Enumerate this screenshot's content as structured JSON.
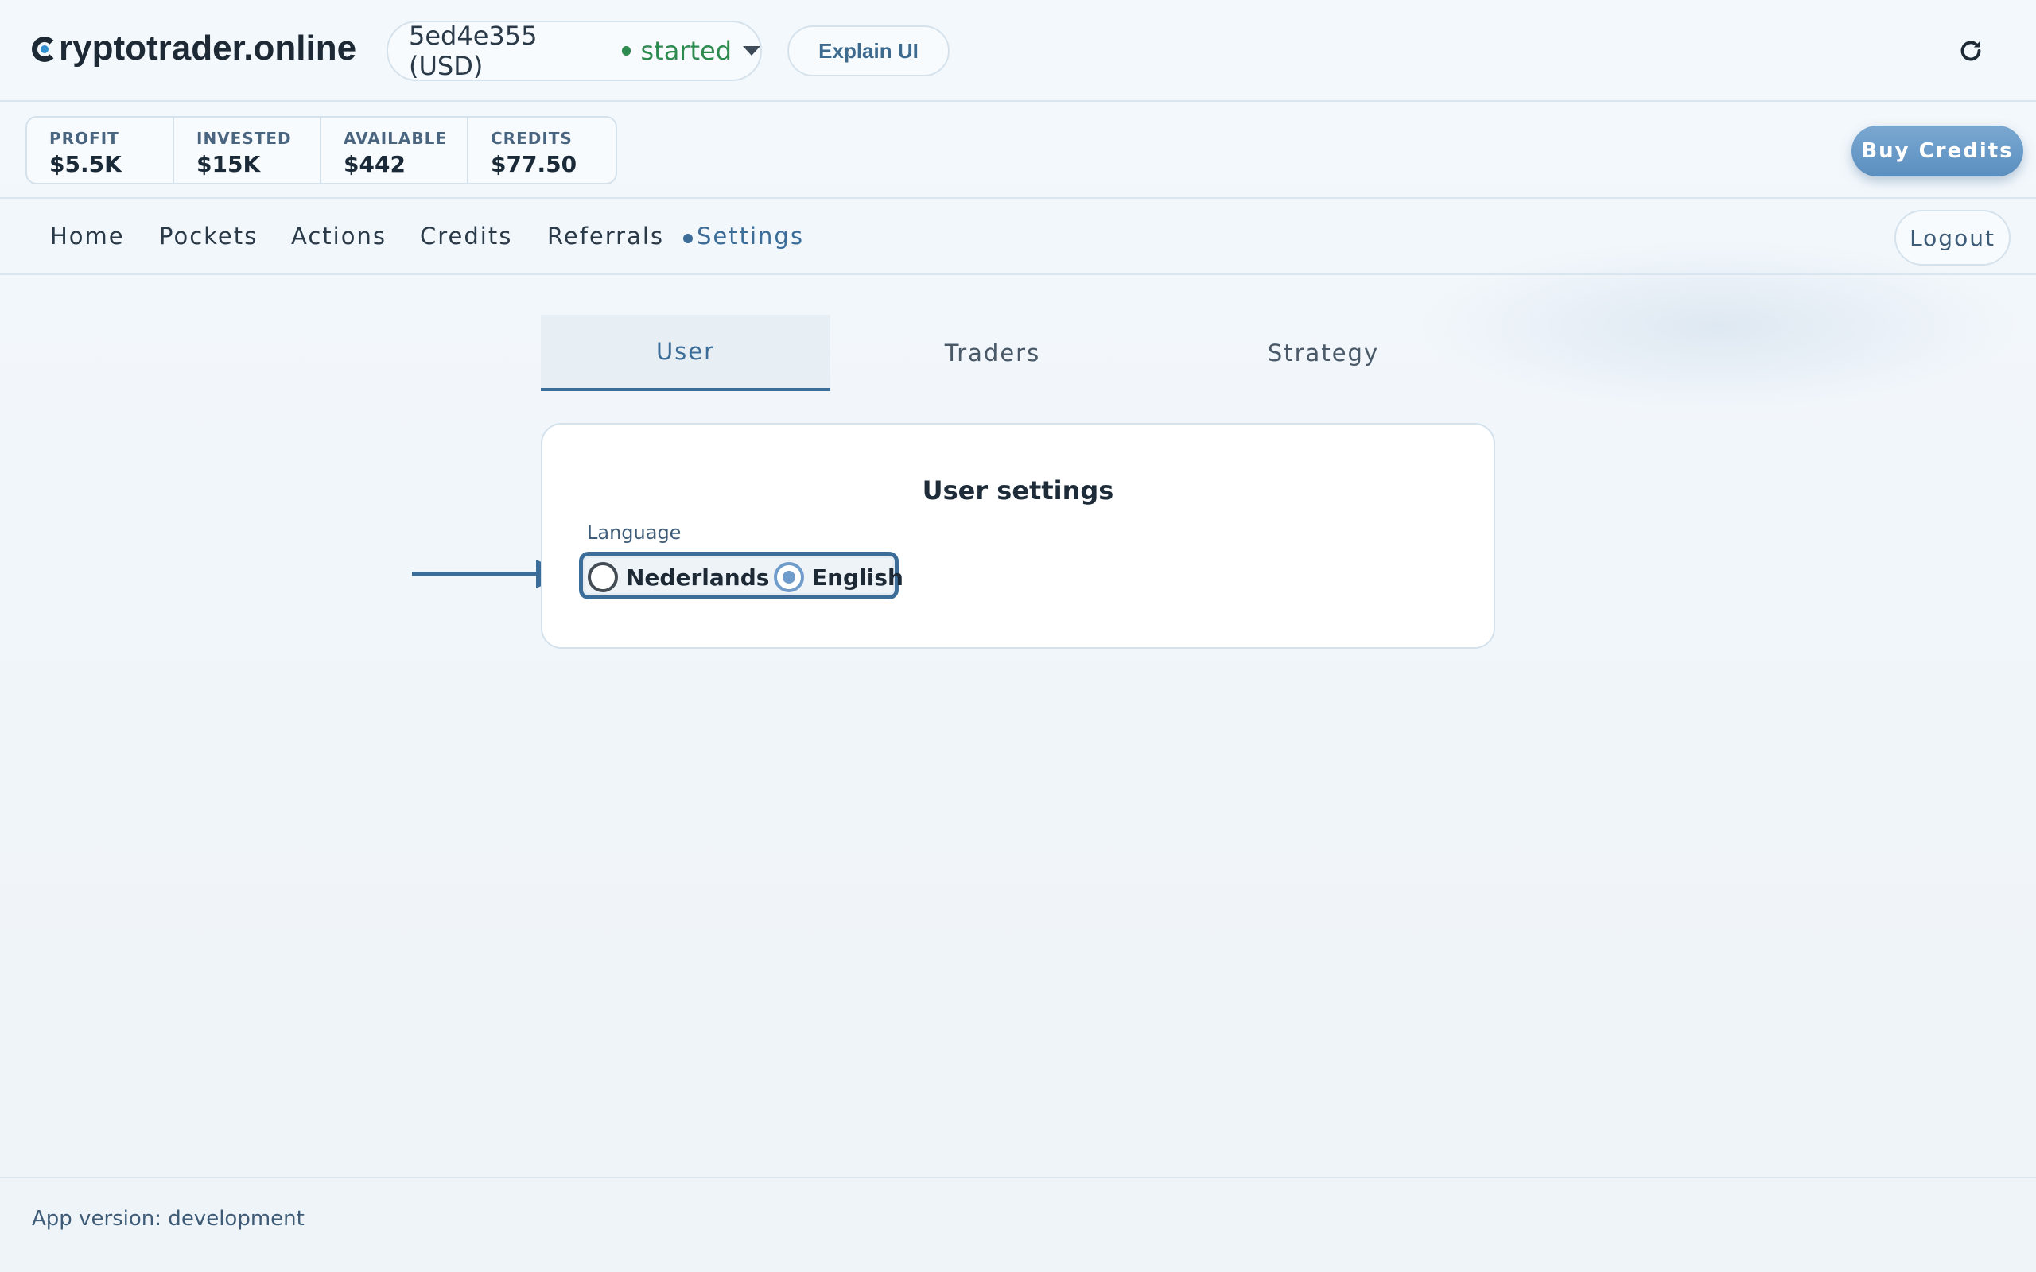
{
  "header": {
    "logo_text": "ryptotrader.online",
    "pocket": {
      "name": "5ed4e355 (USD)",
      "status": "started",
      "status_color": "#2e8b4f"
    },
    "explain_label": "Explain UI",
    "refresh_icon": "refresh-icon"
  },
  "stats": [
    {
      "label": "PROFIT",
      "value": "$5.5K"
    },
    {
      "label": "INVESTED",
      "value": "$15K"
    },
    {
      "label": "AVAILABLE",
      "value": "$442"
    },
    {
      "label": "CREDITS",
      "value": "$77.50"
    }
  ],
  "buy_credits_label": "Buy Credits",
  "nav": {
    "items": [
      {
        "label": "Home"
      },
      {
        "label": "Pockets"
      },
      {
        "label": "Actions"
      },
      {
        "label": "Credits"
      },
      {
        "label": "Referrals"
      },
      {
        "label": "Settings",
        "active": true
      }
    ],
    "logout_label": "Logout"
  },
  "tabs": [
    {
      "label": "User",
      "active": true
    },
    {
      "label": "Traders"
    },
    {
      "label": "Strategy"
    }
  ],
  "user_settings": {
    "title": "User settings",
    "language_label": "Language",
    "options": [
      {
        "label": "Nederlands",
        "selected": false
      },
      {
        "label": "English",
        "selected": true
      }
    ]
  },
  "footer": {
    "version_text": "App version: development"
  },
  "colors": {
    "accent": "#3c6d98",
    "buy_button": "#6a9bc8",
    "status_green": "#2e8b4f"
  }
}
